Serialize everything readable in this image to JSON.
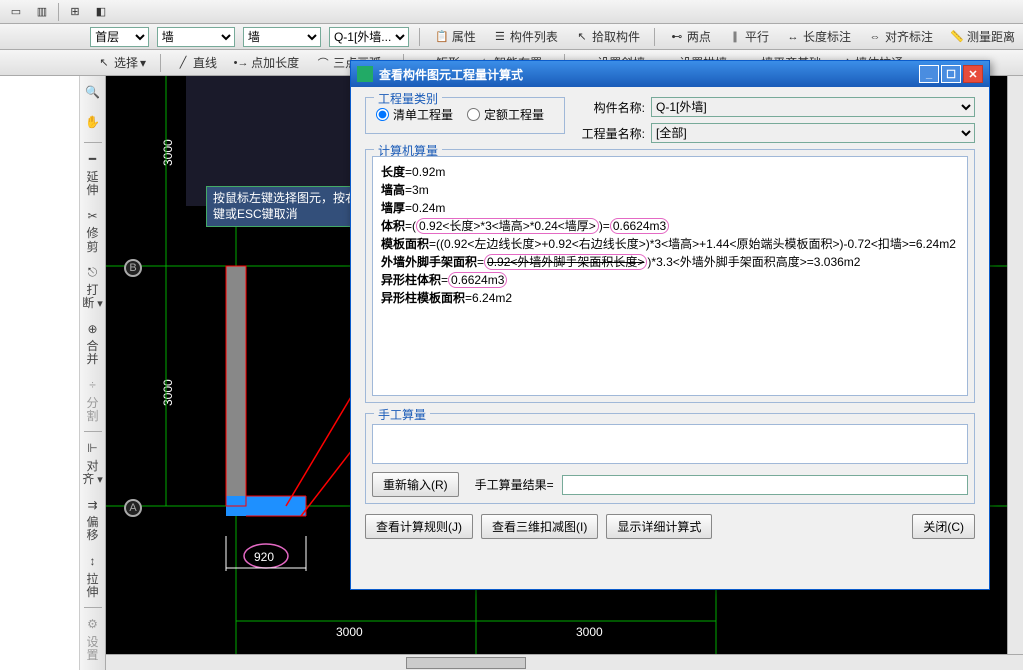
{
  "toolbar1_items": [
    "",
    "",
    "",
    ""
  ],
  "toolbar2": {
    "layer": "首层",
    "cat1": "墙",
    "cat2": "墙",
    "comp": "Q-1[外墙...",
    "btns": [
      "属性",
      "构件列表",
      "拾取构件",
      "两点",
      "平行",
      "长度标注",
      "对齐标注",
      "测量距离"
    ]
  },
  "toolbar3": {
    "sel": "选择",
    "btns": [
      "直线",
      "点加长度",
      "三点画弧",
      "矩形",
      "智能布置",
      "设置斜墙",
      "设置拱墙",
      "墙平齐基础",
      "墙体拉通"
    ]
  },
  "left_tools": [
    "延伸",
    "修剪",
    "打断",
    "合并",
    "分割",
    "对齐",
    "偏移",
    "拉伸",
    "设置"
  ],
  "hint": "按鼠标左键选择图元，按右键或ESC键取消",
  "canvas": {
    "badge_a": "A",
    "badge_b": "B",
    "dim_920": "920",
    "dim_3000a": "3000",
    "dim_3000b": "3000",
    "v_3000a": "3000",
    "v_3000b": "3000"
  },
  "dialog": {
    "title": "查看构件图元工程量计算式",
    "group_type": "工程量类别",
    "radio1": "清单工程量",
    "radio2": "定额工程量",
    "lbl_name": "构件名称:",
    "val_name": "Q-1[外墙]",
    "lbl_qname": "工程量名称:",
    "val_qname": "[全部]",
    "group_calc": "计算机算量",
    "calc_lines": {
      "l1a": "长度",
      "l1b": "=0.92m",
      "l2a": "墙高",
      "l2b": "=3m",
      "l3a": "墙厚",
      "l3b": "=0.24m",
      "l4a": "体积",
      "l4b": "=(",
      "l4c": "0.92<长度>*3<墙高>*0.24<墙厚>",
      "l4d": ")=",
      "l4e": "0.6624m3",
      "l5a": "模板面积",
      "l5b": "=((0.92<左边线长度>+0.92<右边线长度>)*3<墙高>+1.44<原始端头模板面积>)-0.72<扣墙>=6.24m2",
      "l6a": "外墙外脚手架面积",
      "l6b": "=",
      "l6c": "0.92<外墙外脚手架面积长度>",
      "l6d": ")*3.3<外墙外脚手架面积高度>=3.036m2",
      "l7a": "异形柱体积",
      "l7b": "=",
      "l7c": "0.6624m3",
      "l8a": "异形柱模板面积",
      "l8b": "=6.24m2"
    },
    "group_manual": "手工算量",
    "btn_reinput": "重新输入(R)",
    "lbl_result": "手工算量结果=",
    "btn_rule": "查看计算规则(J)",
    "btn_3d": "查看三维扣减图(I)",
    "btn_detail": "显示详细计算式",
    "btn_close": "关闭(C)"
  }
}
